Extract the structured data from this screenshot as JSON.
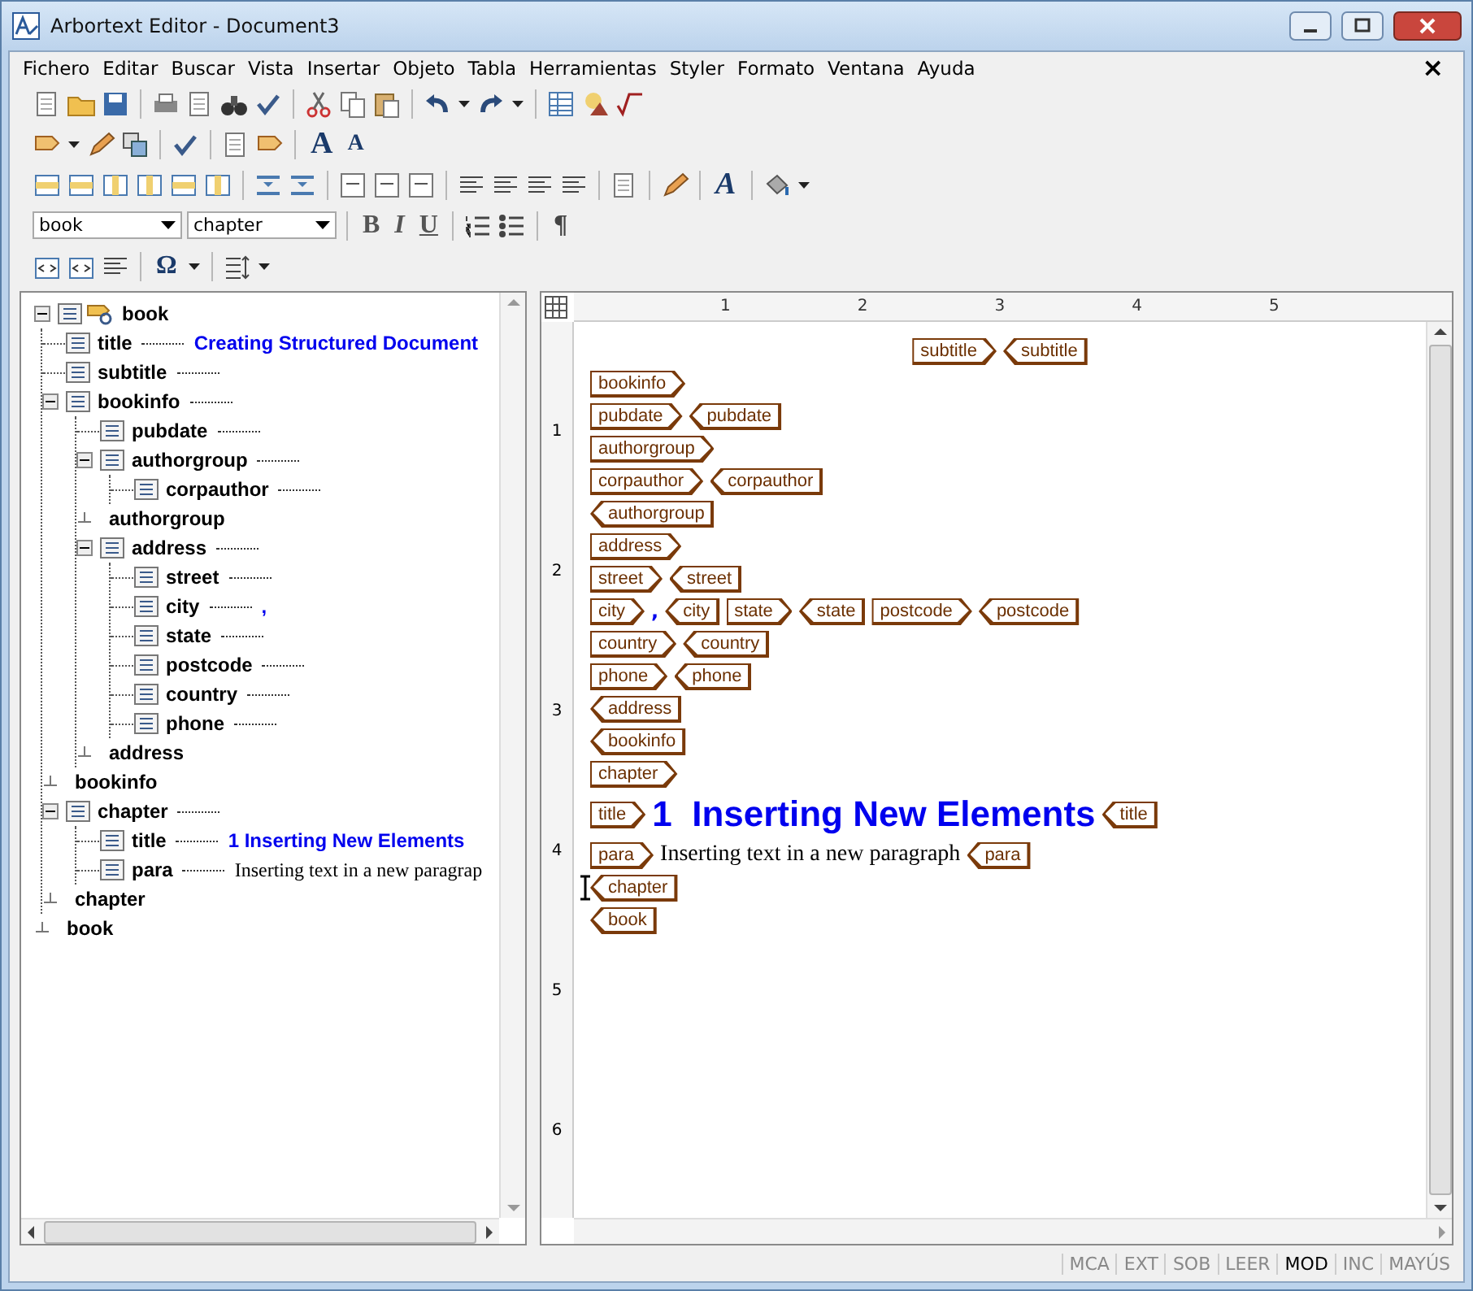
{
  "window": {
    "title": "Arbortext Editor - Document3",
    "close_glyph": "×"
  },
  "menu": [
    "Fichero",
    "Editar",
    "Buscar",
    "Vista",
    "Insertar",
    "Objeto",
    "Tabla",
    "Herramientas",
    "Styler",
    "Formato",
    "Ventana",
    "Ayuda"
  ],
  "toolbar": {
    "font_size_buttons": [
      "A",
      "A"
    ],
    "style_button": "A",
    "element_combos": [
      {
        "value": "book"
      },
      {
        "value": "chapter"
      }
    ],
    "format_buttons": [
      "B",
      "I",
      "U"
    ],
    "pilcrow": "¶",
    "symbol_button": "Ω"
  },
  "tree": {
    "name": "book",
    "expanded": true,
    "end_label": "book",
    "children": [
      {
        "name": "title",
        "text": "Creating Structured Document",
        "kind": "heading"
      },
      {
        "name": "subtitle"
      },
      {
        "name": "bookinfo",
        "expanded": true,
        "end_label": "bookinfo",
        "children": [
          {
            "name": "pubdate"
          },
          {
            "name": "authorgroup",
            "expanded": true,
            "end_label": "authorgroup",
            "children": [
              {
                "name": "corpauthor"
              }
            ]
          },
          {
            "name": "address",
            "expanded": true,
            "end_label": "address",
            "children": [
              {
                "name": "street"
              },
              {
                "name": "city",
                "text": ",",
                "kind": "heading"
              },
              {
                "name": "state"
              },
              {
                "name": "postcode"
              },
              {
                "name": "country"
              },
              {
                "name": "phone"
              }
            ]
          }
        ]
      },
      {
        "name": "chapter",
        "expanded": true,
        "end_label": "chapter",
        "children": [
          {
            "name": "title",
            "text": "1  Inserting New Elements",
            "kind": "heading"
          },
          {
            "name": "para",
            "text": "Inserting text in a new paragrap",
            "kind": "text"
          }
        ]
      }
    ]
  },
  "ruler": {
    "marks": [
      "1",
      "2",
      "3",
      "4",
      "5"
    ]
  },
  "vertical_ruler": {
    "marks": [
      "1",
      "2",
      "3",
      "4",
      "5",
      "6"
    ]
  },
  "document": [
    {
      "centered": true,
      "segments": [
        {
          "kind": "start",
          "text": "subtitle"
        },
        {
          "kind": "end",
          "text": "subtitle"
        }
      ]
    },
    {
      "segments": [
        {
          "kind": "start",
          "text": "bookinfo"
        }
      ]
    },
    {
      "segments": [
        {
          "kind": "start",
          "text": "pubdate"
        },
        {
          "kind": "end",
          "text": "pubdate"
        }
      ]
    },
    {
      "segments": [
        {
          "kind": "start",
          "text": "authorgroup"
        }
      ]
    },
    {
      "segments": [
        {
          "kind": "start",
          "text": "corpauthor"
        },
        {
          "kind": "end",
          "text": "corpauthor"
        }
      ]
    },
    {
      "segments": [
        {
          "kind": "end",
          "text": "authorgroup"
        }
      ]
    },
    {
      "segments": [
        {
          "kind": "start",
          "text": "address"
        }
      ]
    },
    {
      "segments": [
        {
          "kind": "start",
          "text": "street"
        },
        {
          "kind": "end",
          "text": "street"
        }
      ]
    },
    {
      "segments": [
        {
          "kind": "start",
          "text": "city"
        },
        {
          "kind": "punct",
          "text": ","
        },
        {
          "kind": "end",
          "text": "city"
        },
        {
          "kind": "start",
          "text": "state"
        },
        {
          "kind": "end",
          "text": "state"
        },
        {
          "kind": "start",
          "text": "postcode"
        },
        {
          "kind": "end",
          "text": "postcode"
        }
      ]
    },
    {
      "segments": [
        {
          "kind": "start",
          "text": "country"
        },
        {
          "kind": "end",
          "text": "country"
        }
      ]
    },
    {
      "segments": [
        {
          "kind": "start",
          "text": "phone"
        },
        {
          "kind": "end",
          "text": "phone"
        }
      ]
    },
    {
      "segments": [
        {
          "kind": "end",
          "text": "address"
        }
      ]
    },
    {
      "segments": [
        {
          "kind": "end",
          "text": "bookinfo"
        }
      ]
    },
    {
      "segments": [
        {
          "kind": "start",
          "text": "chapter"
        }
      ]
    },
    {
      "segments": [
        {
          "kind": "start",
          "text": "title"
        },
        {
          "kind": "heading",
          "text": "1  Inserting New Elements"
        },
        {
          "kind": "end",
          "text": "title"
        }
      ]
    },
    {
      "segments": [
        {
          "kind": "start",
          "text": "para"
        },
        {
          "kind": "text",
          "text": "Inserting text in a new paragraph"
        },
        {
          "kind": "end",
          "text": "para"
        }
      ]
    },
    {
      "cursor": true,
      "segments": [
        {
          "kind": "end",
          "text": "chapter"
        }
      ]
    },
    {
      "segments": [
        {
          "kind": "end",
          "text": "book"
        }
      ]
    }
  ],
  "status_bar": [
    {
      "label": "MCA",
      "on": false
    },
    {
      "label": "EXT",
      "on": false
    },
    {
      "label": "SOB",
      "on": false
    },
    {
      "label": "LEER",
      "on": false
    },
    {
      "label": "MOD",
      "on": true
    },
    {
      "label": "INC",
      "on": false
    },
    {
      "label": "MAYÚS",
      "on": false
    }
  ]
}
